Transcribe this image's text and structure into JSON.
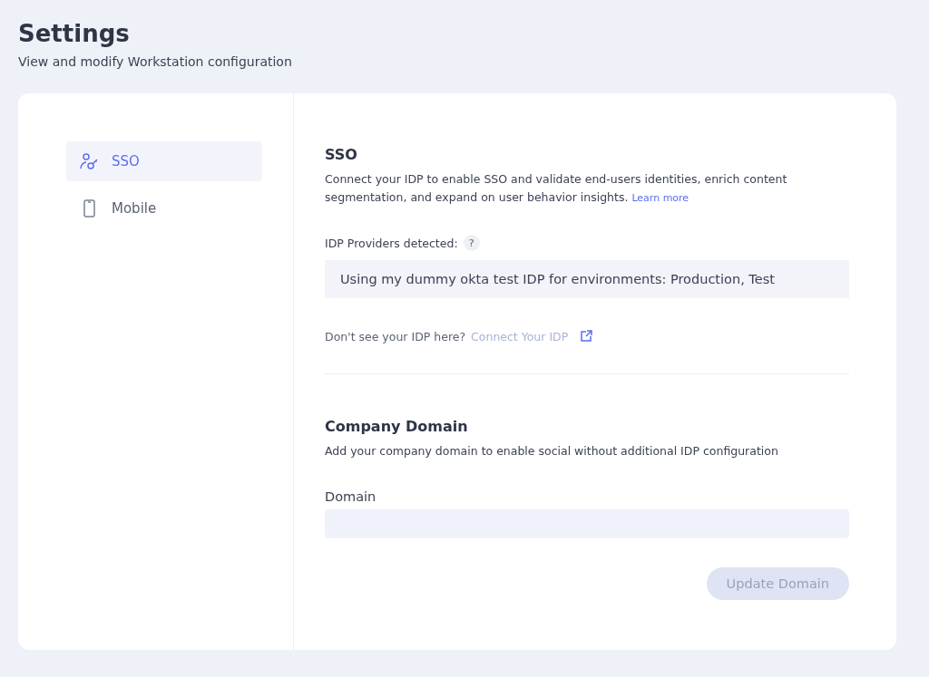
{
  "header": {
    "title": "Settings",
    "subtitle": "View and modify Workstation configuration"
  },
  "sidebar": {
    "items": [
      {
        "label": "SSO",
        "kind": "sso",
        "selected": true
      },
      {
        "label": "Mobile",
        "kind": "mobile",
        "selected": false
      }
    ]
  },
  "sso": {
    "title": "SSO",
    "description": "Connect your IDP to enable SSO and validate end-users identities, enrich content segmentation, and expand on user behavior insights.",
    "learn_more": "Learn more",
    "providers_label": "IDP Providers detected:",
    "help": "?",
    "provider_value": "Using my dummy okta test IDP for environments: Production, Test",
    "missing_text": "Don't see your IDP here?",
    "connect_link": "Connect Your IDP"
  },
  "company_domain": {
    "title": "Company Domain",
    "description": "Add your company domain to enable social without additional IDP configuration",
    "field_label": "Domain",
    "button": {
      "label": "Update Domain",
      "disabled": true
    }
  }
}
